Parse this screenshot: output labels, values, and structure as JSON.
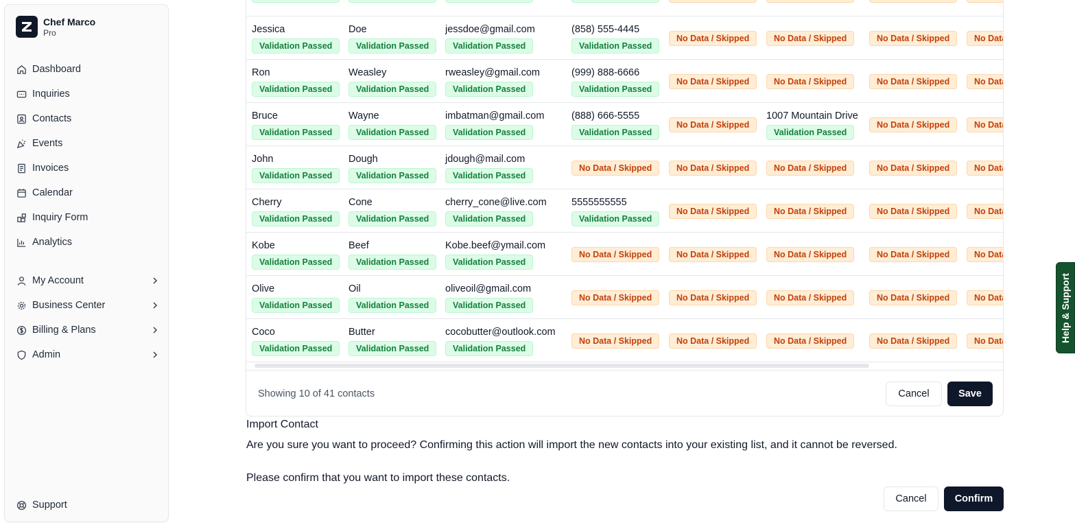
{
  "brand": {
    "name": "Chef Marco",
    "plan": "Pro"
  },
  "nav": {
    "main": [
      {
        "key": "dashboard",
        "label": "Dashboard",
        "icon": "home-icon"
      },
      {
        "key": "inquiries",
        "label": "Inquiries",
        "icon": "inbox-icon"
      },
      {
        "key": "contacts",
        "label": "Contacts",
        "icon": "contact-card-icon"
      },
      {
        "key": "events",
        "label": "Events",
        "icon": "party-icon"
      },
      {
        "key": "invoices",
        "label": "Invoices",
        "icon": "document-icon"
      },
      {
        "key": "calendar",
        "label": "Calendar",
        "icon": "calendar-icon"
      },
      {
        "key": "inquiry-form",
        "label": "Inquiry Form",
        "icon": "form-blocks-icon"
      },
      {
        "key": "analytics",
        "label": "Analytics",
        "icon": "bar-chart-icon"
      }
    ],
    "account": [
      {
        "key": "my-account",
        "label": "My Account",
        "icon": "user-icon"
      },
      {
        "key": "business-center",
        "label": "Business Center",
        "icon": "gear-icon"
      },
      {
        "key": "billing-plans",
        "label": "Billing & Plans",
        "icon": "dollar-circle-icon"
      },
      {
        "key": "admin",
        "label": "Admin",
        "icon": "shield-icon"
      }
    ],
    "support": {
      "label": "Support",
      "icon": "lifebuoy-icon"
    }
  },
  "status": {
    "passed": "Validation Passed",
    "skipped": "No Data / Skipped"
  },
  "columns_x": [
    8,
    149,
    290,
    474,
    616,
    758,
    908,
    1050
  ],
  "rows": [
    {
      "cells": [
        {
          "s": "passed"
        },
        {
          "s": "passed"
        },
        {
          "s": "passed"
        },
        {
          "s": "passed"
        },
        {
          "s": "skipped"
        },
        {
          "s": "skipped"
        },
        {
          "s": "skipped"
        },
        {
          "s": "skipped"
        }
      ]
    },
    {
      "cells": [
        {
          "v": "Jessica",
          "s": "passed"
        },
        {
          "v": "Doe",
          "s": "passed"
        },
        {
          "v": "jessdoe@gmail.com",
          "s": "passed"
        },
        {
          "v": "(858) 555-4445",
          "s": "passed"
        },
        {
          "s": "skipped"
        },
        {
          "s": "skipped"
        },
        {
          "s": "skipped"
        },
        {
          "s": "skipped"
        }
      ]
    },
    {
      "cells": [
        {
          "v": "Ron",
          "s": "passed"
        },
        {
          "v": "Weasley",
          "s": "passed"
        },
        {
          "v": "rweasley@gmail.com",
          "s": "passed"
        },
        {
          "v": "(999) 888-6666",
          "s": "passed"
        },
        {
          "s": "skipped"
        },
        {
          "s": "skipped"
        },
        {
          "s": "skipped"
        },
        {
          "s": "skipped"
        }
      ]
    },
    {
      "cells": [
        {
          "v": "Bruce",
          "s": "passed"
        },
        {
          "v": "Wayne",
          "s": "passed"
        },
        {
          "v": "imbatman@gmail.com",
          "s": "passed"
        },
        {
          "v": "(888) 666-5555",
          "s": "passed"
        },
        {
          "s": "skipped"
        },
        {
          "v": "1007 Mountain Drive",
          "s": "passed"
        },
        {
          "s": "skipped"
        },
        {
          "s": "skipped"
        }
      ]
    },
    {
      "cells": [
        {
          "v": "John",
          "s": "passed"
        },
        {
          "v": "Dough",
          "s": "passed"
        },
        {
          "v": "jdough@mail.com",
          "s": "passed"
        },
        {
          "s": "skipped"
        },
        {
          "s": "skipped"
        },
        {
          "s": "skipped"
        },
        {
          "s": "skipped"
        },
        {
          "s": "skipped"
        }
      ]
    },
    {
      "cells": [
        {
          "v": "Cherry",
          "s": "passed"
        },
        {
          "v": "Cone",
          "s": "passed"
        },
        {
          "v": "cherry_cone@live.com",
          "s": "passed"
        },
        {
          "v": "5555555555",
          "s": "passed"
        },
        {
          "s": "skipped"
        },
        {
          "s": "skipped"
        },
        {
          "s": "skipped"
        },
        {
          "s": "skipped"
        }
      ]
    },
    {
      "cells": [
        {
          "v": "Kobe",
          "s": "passed"
        },
        {
          "v": "Beef",
          "s": "passed"
        },
        {
          "v": "Kobe.beef@ymail.com",
          "s": "passed"
        },
        {
          "s": "skipped"
        },
        {
          "s": "skipped"
        },
        {
          "s": "skipped"
        },
        {
          "s": "skipped"
        },
        {
          "s": "skipped"
        }
      ]
    },
    {
      "cells": [
        {
          "v": "Olive",
          "s": "passed"
        },
        {
          "v": "Oil",
          "s": "passed"
        },
        {
          "v": "oliveoil@gmail.com",
          "s": "passed"
        },
        {
          "s": "skipped"
        },
        {
          "s": "skipped"
        },
        {
          "s": "skipped"
        },
        {
          "s": "skipped"
        },
        {
          "s": "skipped"
        }
      ]
    },
    {
      "cells": [
        {
          "v": "Coco",
          "s": "passed"
        },
        {
          "v": "Butter",
          "s": "passed"
        },
        {
          "v": "cocobutter@outlook.com",
          "s": "passed"
        },
        {
          "s": "skipped"
        },
        {
          "s": "skipped"
        },
        {
          "s": "skipped"
        },
        {
          "s": "skipped"
        },
        {
          "s": "skipped"
        }
      ]
    }
  ],
  "table_footer": {
    "showing": "Showing 10 of 41 contacts",
    "cancel": "Cancel",
    "save": "Save"
  },
  "import": {
    "title": "Import Contact",
    "text1": "Are you sure you want to proceed? Confirming this action will import the new contacts into your existing list, and it cannot be reversed.",
    "text2": "Please confirm that you want to import these contacts.",
    "cancel": "Cancel",
    "confirm": "Confirm"
  },
  "help": {
    "label": "Help & Support"
  },
  "colors": {
    "passed_bg": "#dcfce7",
    "passed_text": "#15803d",
    "skipped_bg": "#ffedd5",
    "skipped_text": "#c2410c",
    "primary": "#0f172a",
    "help_tab": "#14532d"
  }
}
